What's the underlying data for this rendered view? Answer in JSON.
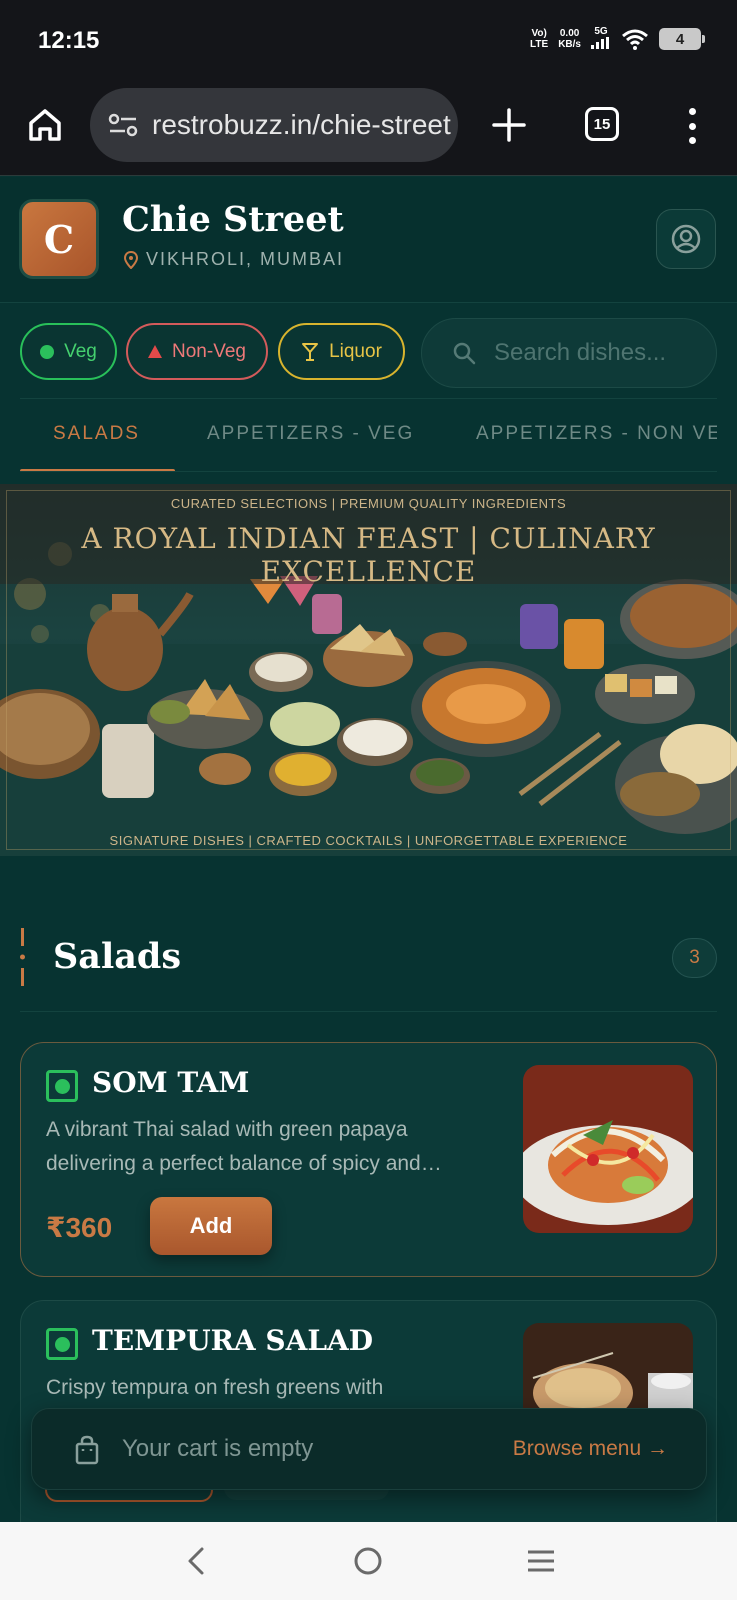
{
  "status_bar": {
    "time": "12:15",
    "network_top": "Vo)",
    "network_bottom": "LTE",
    "speed_value": "0.00",
    "speed_unit": "KB/s",
    "signal_label": "5G",
    "battery_level": "4"
  },
  "browser": {
    "url": "restrobuzz.in/chie-street",
    "tab_count": "15"
  },
  "restaurant": {
    "logo_letter": "C",
    "name": "Chie Street",
    "location": "VIKHROLI, MUMBAI"
  },
  "filters": {
    "veg_label": "Veg",
    "nonveg_label": "Non-Veg",
    "liquor_label": "Liquor",
    "search_placeholder": "Search dishes..."
  },
  "category_tabs": [
    {
      "label": "SALADS",
      "active": true
    },
    {
      "label": "APPETIZERS - VEG",
      "active": false
    },
    {
      "label": "APPETIZERS - NON VEG",
      "active": false
    }
  ],
  "banner": {
    "top_line": "CURATED SELECTIONS | PREMIUM QUALITY INGREDIENTS",
    "title": "A ROYAL INDIAN FEAST | CULINARY EXCELLENCE",
    "bottom_line": "SIGNATURE DISHES | CRAFTED COCKTAILS | UNFORGETTABLE EXPERIENCE"
  },
  "section": {
    "title": "Salads",
    "count": "3"
  },
  "dishes": [
    {
      "name": "SOM TAM",
      "description": "A vibrant Thai salad with green papaya delivering a perfect balance of spicy and…",
      "price": "₹360",
      "add_label": "Add",
      "type": "veg"
    },
    {
      "name": "TEMPURA SALAD",
      "description": "Crispy tempura on fresh greens with",
      "type": "veg"
    }
  ],
  "cart": {
    "empty_text": "Your cart is empty",
    "browse_link": "Browse menu →"
  },
  "colors": {
    "background": "#073331",
    "accent": "#c97a45",
    "veg": "#2bbf5c",
    "nonveg": "#d35b5b",
    "liquor": "#d8b42e"
  }
}
